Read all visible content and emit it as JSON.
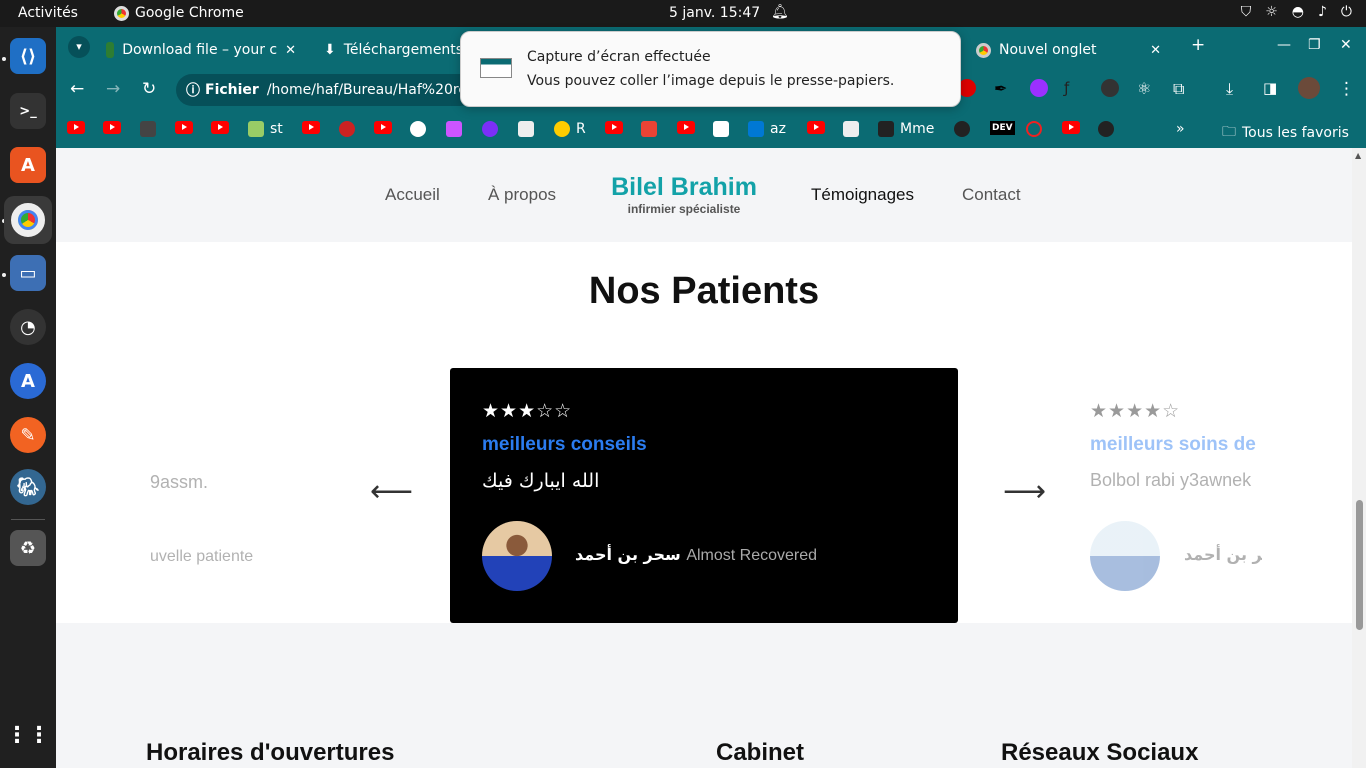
{
  "system": {
    "activities": "Activités",
    "app_name": "Google Chrome",
    "clock": "5 janv.  15:47"
  },
  "browser": {
    "tabs": [
      {
        "label": "Download file – your c"
      },
      {
        "label": "Téléchargements"
      },
      {
        "label": "Nouvel onglet"
      }
    ],
    "omnibox": {
      "chip": "Fichier",
      "url": "/home/haf/Bureau/Haf%20rep"
    },
    "bookmarks": {
      "st": "st",
      "r": "R",
      "az": "az",
      "mme": "Mme",
      "dev": "DEV",
      "all": "Tous les favoris"
    }
  },
  "notification": {
    "title": "Capture d’écran effectuée",
    "body": "Vous pouvez coller l’image depuis le presse-papiers."
  },
  "site": {
    "nav": {
      "accueil": "Accueil",
      "apropos": "À propos",
      "brand_name": "Bilel Brahim",
      "brand_sub": "infirmier spécialiste",
      "temoignages": "Témoignages",
      "contact": "Contact"
    },
    "section_title": "Nos Patients",
    "testimonials": {
      "left": {
        "text": "9assm.",
        "author": "uvelle patiente"
      },
      "center": {
        "stars": "★★★☆☆",
        "rating": 3,
        "title": "meilleurs conseils",
        "text": "الله ايبارك فيك",
        "author_name": "سحر بن أحمد",
        "author_status": "Almost Recovered"
      },
      "right": {
        "stars": "★★★★☆",
        "rating": 4,
        "title": "meilleurs soins de",
        "text": "Bolbol rabi y3awnek",
        "author_name": "سحر بن أحمد"
      }
    },
    "footer": {
      "col1": "Horaires d'ouvertures",
      "col2": "Cabinet",
      "col3": "Réseaux Sociaux"
    }
  }
}
